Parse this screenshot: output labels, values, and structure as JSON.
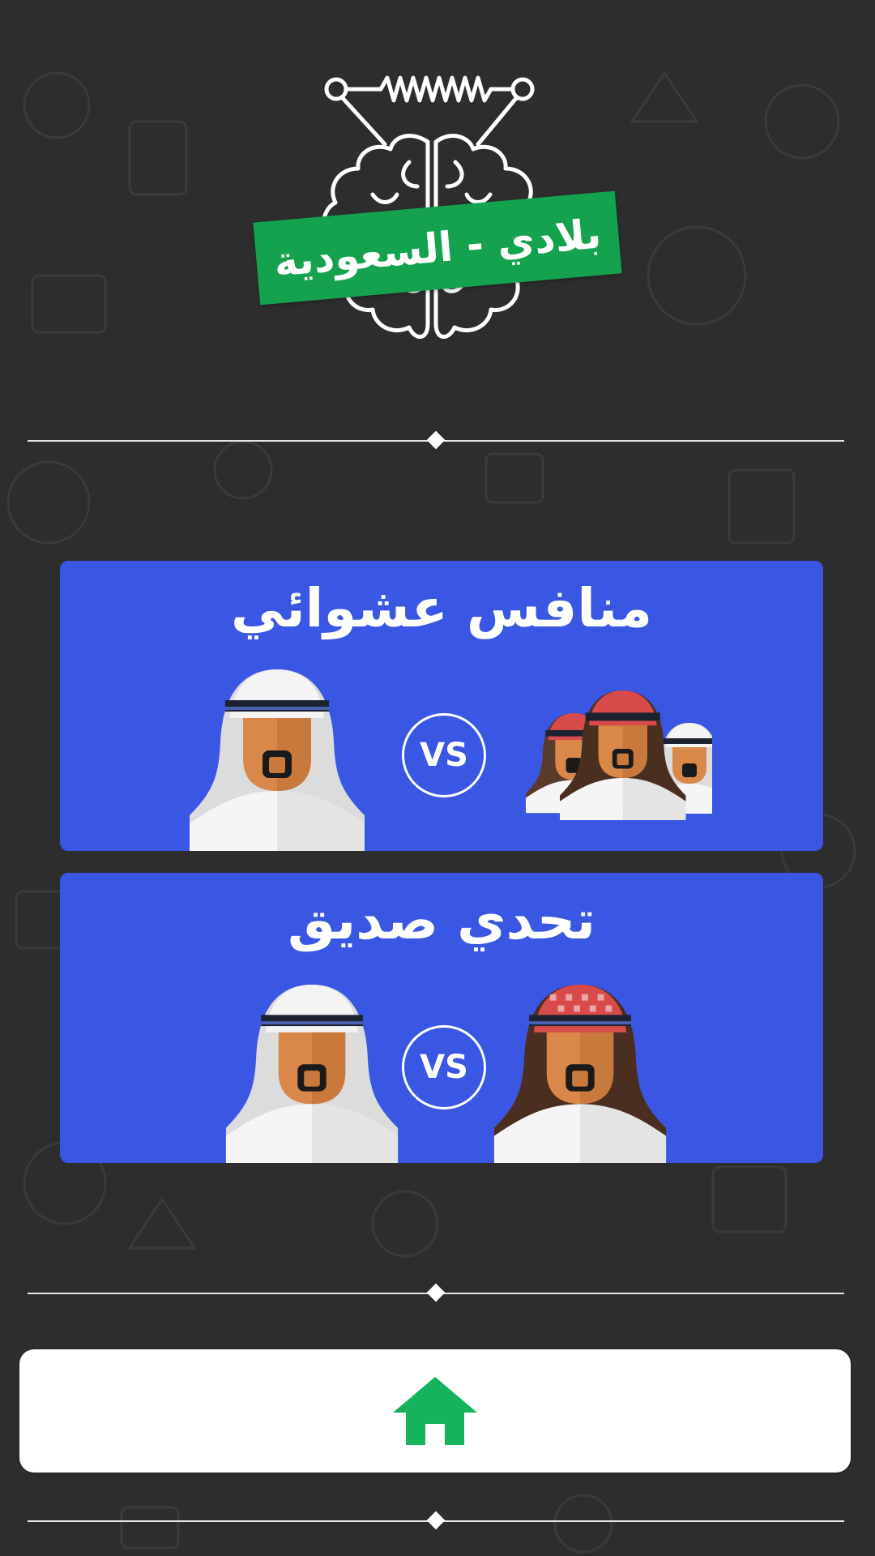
{
  "app": {
    "logo_text": "بلادي - السعودية"
  },
  "modes": [
    {
      "title": "منافس عشوائي",
      "vs_label": "VS"
    },
    {
      "title": "تحدي صديق",
      "vs_label": "VS"
    }
  ],
  "colors": {
    "background": "#2d2d2d",
    "card": "#3a57e3",
    "accent_green": "#15a24f",
    "home_icon": "#15b45c"
  },
  "icons": {
    "home": "home-icon",
    "brain": "brain-icon"
  }
}
